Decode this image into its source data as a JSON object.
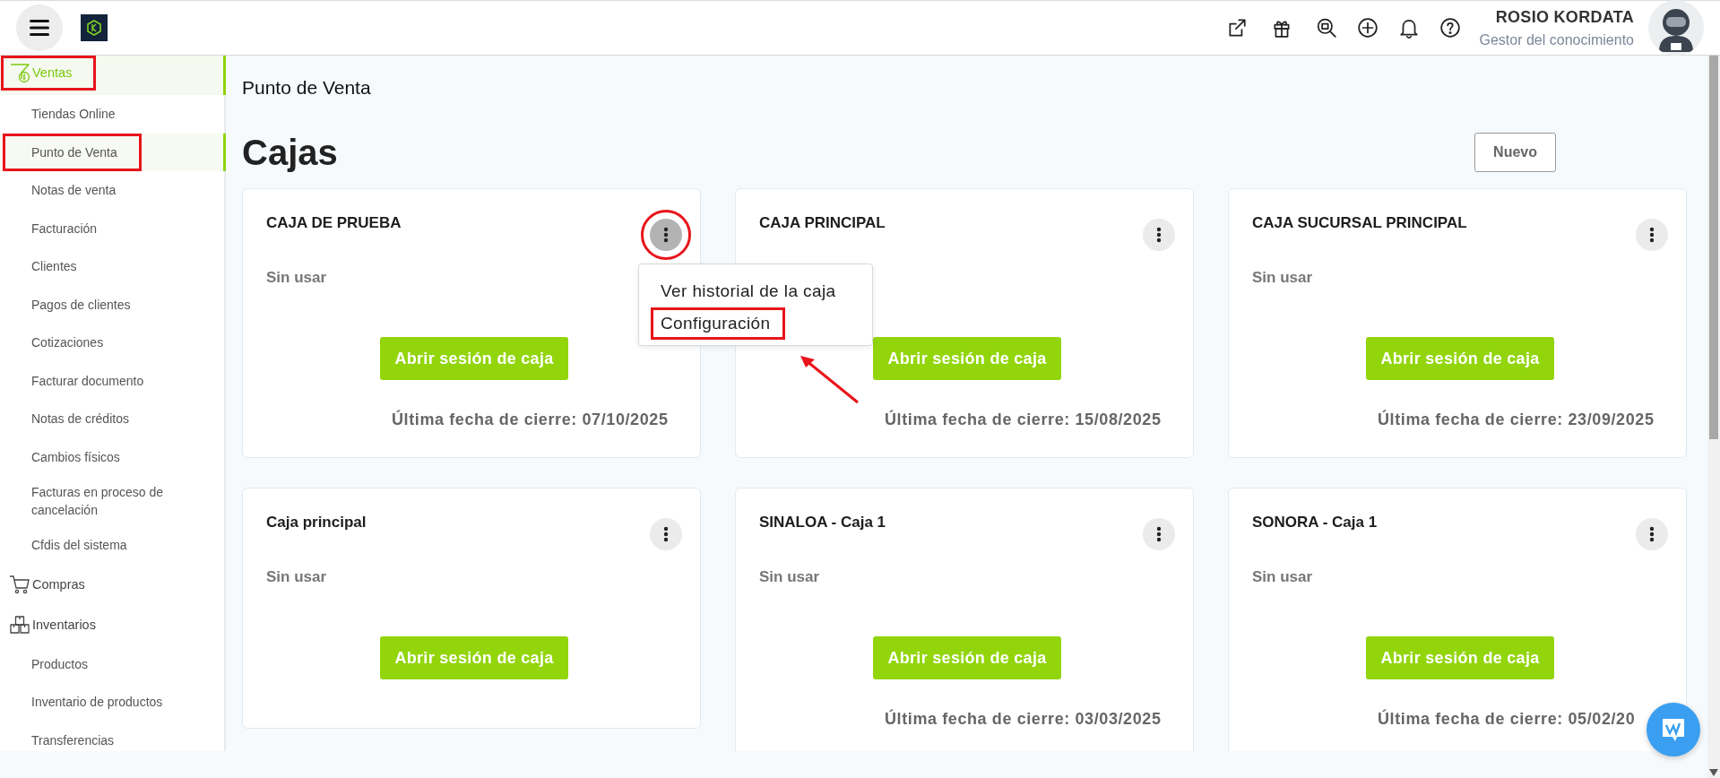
{
  "header": {
    "user_name": "ROSIO KORDATA",
    "user_role": "Gestor del conocimiento"
  },
  "sidebar": {
    "groups": [
      {
        "label": "Ventas",
        "selected": true,
        "highlighted": true,
        "children": [
          {
            "label": "Tiendas Online",
            "selected": false,
            "highlighted": false
          },
          {
            "label": "Punto de Venta",
            "selected": true,
            "highlighted": true
          },
          {
            "label": "Notas de venta",
            "selected": false,
            "highlighted": false
          },
          {
            "label": "Facturación",
            "selected": false,
            "highlighted": false
          },
          {
            "label": "Clientes",
            "selected": false,
            "highlighted": false
          },
          {
            "label": "Pagos de clientes",
            "selected": false,
            "highlighted": false
          },
          {
            "label": "Cotizaciones",
            "selected": false,
            "highlighted": false
          },
          {
            "label": "Facturar documento",
            "selected": false,
            "highlighted": false
          },
          {
            "label": "Notas de créditos",
            "selected": false,
            "highlighted": false
          },
          {
            "label": "Cambios físicos",
            "selected": false,
            "highlighted": false
          },
          {
            "label": "Facturas en proceso de cancelación",
            "selected": false,
            "highlighted": false
          },
          {
            "label": "Cfdis del sistema",
            "selected": false,
            "highlighted": false
          }
        ]
      },
      {
        "label": "Compras",
        "selected": false,
        "highlighted": false
      },
      {
        "label": "Inventarios",
        "selected": false,
        "highlighted": false,
        "children": [
          {
            "label": "Productos",
            "selected": false,
            "highlighted": false
          },
          {
            "label": "Inventario de productos",
            "selected": false,
            "highlighted": false
          },
          {
            "label": "Transferencias",
            "selected": false,
            "highlighted": false
          }
        ]
      }
    ]
  },
  "page_title": "Punto de Venta",
  "heading": "Cajas",
  "new_button": "Nuevo",
  "cards": [
    {
      "title": "CAJA DE PRUEBA",
      "status": "Sin usar",
      "button": "Abrir sesión de caja",
      "last_close": "Última fecha de cierre: 07/10/2025",
      "menu_active": true,
      "menu_highlighted": true,
      "menu": [
        {
          "label": "Ver historial de la caja",
          "highlighted": false
        },
        {
          "label": "Configuración",
          "highlighted": true
        }
      ]
    },
    {
      "title": "CAJA PRINCIPAL",
      "button": "Abrir sesión de caja",
      "last_close": "Última fecha de cierre: 15/08/2025",
      "menu_active": false,
      "menu_highlighted": false
    },
    {
      "title": "CAJA SUCURSAL PRINCIPAL",
      "status": "Sin usar",
      "button": "Abrir sesión de caja",
      "last_close": "Última fecha de cierre: 23/09/2025",
      "menu_active": false,
      "menu_highlighted": false
    },
    {
      "title": "Caja principal",
      "status": "Sin usar",
      "button": "Abrir sesión de caja",
      "menu_active": false,
      "menu_highlighted": false
    },
    {
      "title": "SINALOA - Caja 1",
      "status": "Sin usar",
      "button": "Abrir sesión de caja",
      "last_close": "Última fecha de cierre: 03/03/2025",
      "menu_active": false,
      "menu_highlighted": false
    },
    {
      "title": "SONORA - Caja 1",
      "status": "Sin usar",
      "button": "Abrir sesión de caja",
      "last_close": "Última fecha de cierre: 05/02/20",
      "menu_active": false,
      "menu_highlighted": false
    }
  ]
}
